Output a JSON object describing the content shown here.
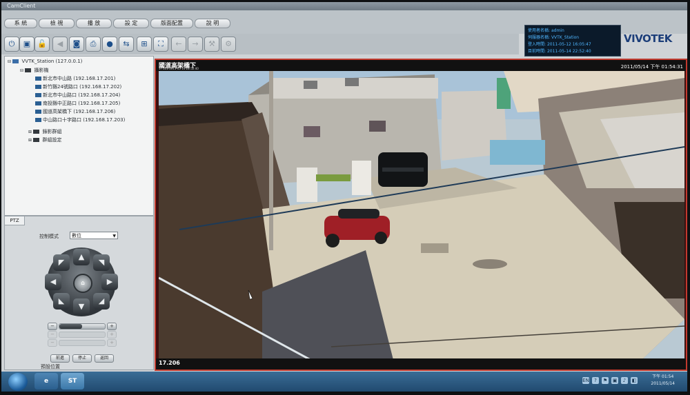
{
  "window": {
    "title": "CamClient"
  },
  "menu": {
    "items": [
      {
        "label": "系 統"
      },
      {
        "label": "檢 視"
      },
      {
        "label": "播 放"
      },
      {
        "label": "設 定"
      },
      {
        "label": "版面配置"
      },
      {
        "label": "說 明"
      }
    ]
  },
  "toolbar": {
    "buttons": [
      {
        "name": "power-icon",
        "glyph": "⏻"
      },
      {
        "name": "layout-icon",
        "glyph": "▣"
      },
      {
        "name": "lock-icon",
        "glyph": "🔓"
      },
      {
        "name": "speaker-icon",
        "glyph": "◀"
      },
      {
        "name": "snapshot-icon",
        "glyph": "◙"
      },
      {
        "name": "print-icon",
        "glyph": "⎙"
      },
      {
        "name": "record-icon",
        "glyph": "●"
      },
      {
        "name": "stream-icon",
        "glyph": "⇆"
      },
      {
        "name": "grid-icon",
        "glyph": "⊞"
      },
      {
        "name": "fullscreen-icon",
        "glyph": "⛶"
      },
      {
        "name": "back-icon",
        "glyph": "←"
      },
      {
        "name": "forward-icon",
        "glyph": "→"
      },
      {
        "name": "tool-icon",
        "glyph": "⚒"
      },
      {
        "name": "settings-icon",
        "glyph": "⚙"
      }
    ]
  },
  "status": {
    "rows": [
      {
        "label": "使用者名稱",
        "value": "admin"
      },
      {
        "label": "伺服器名稱",
        "value": "VVTK_Station"
      },
      {
        "label": "登入時間",
        "value": "2011-05-12 16:05:47"
      },
      {
        "label": "目前時間",
        "value": "2011-05-14 22:52:40"
      }
    ]
  },
  "brand": {
    "logo": "VIVOTEK"
  },
  "tree": {
    "server": "VVTK_Station (127.0.0.1)",
    "group": "攝影機",
    "cameras": [
      "新北市中山路 (192.168.17.201)",
      "新竹縣24號路口 (192.168.17.202)",
      "新北市中山路口 (192.168.17.204)",
      "南投縣中正路口 (192.168.17.205)",
      "國道高架橋下 (192.168.17.206)",
      "中山路口十字路口 (192.168.17.203)"
    ],
    "folders": [
      "錄影群組",
      "群組設定"
    ]
  },
  "ptz": {
    "tab": "PTZ",
    "mode_label": "控制模式",
    "mode_value": "數位",
    "preset_label": "預設位置",
    "buttons": [
      "前進",
      "停止",
      "返回"
    ],
    "zoom_fill": 0.5
  },
  "video": {
    "title": "國道高架橋下",
    "subtitle": "17.206 2011-05-14 22:52:40",
    "timestamp": "2011/05/14 下午 01:54:31",
    "footer": "17.206"
  },
  "taskbar": {
    "apps": [
      {
        "name": "ie-icon",
        "glyph": "e"
      },
      {
        "name": "camclient-app-icon",
        "glyph": "ST"
      }
    ],
    "tray": [
      "EN",
      "?",
      "⚑",
      "▣",
      "♪",
      "◧"
    ],
    "time": "下午 01:54",
    "date": "2011/05/14"
  },
  "colors": {
    "accent_red": "#c23a2e",
    "status_text": "#4fb6ff",
    "brand_blue": "#1c3e79"
  }
}
